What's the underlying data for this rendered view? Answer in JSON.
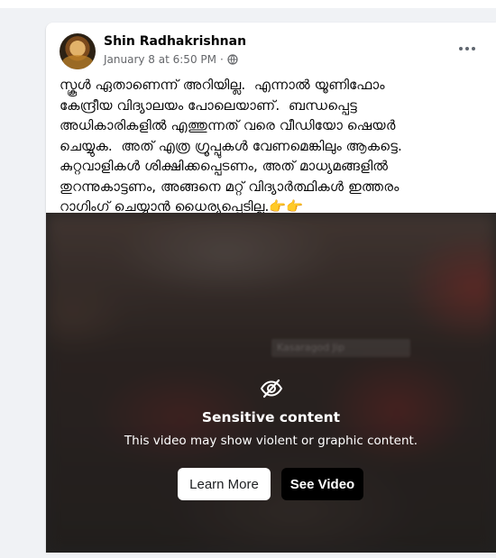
{
  "post": {
    "author": "Shin Radhakrishnan",
    "timestamp": "January 8 at 6:50 PM",
    "separator": "·",
    "audience_icon": "globe-icon",
    "more_icon": "ellipsis-icon",
    "text_lines": [
      "സ്കൂൾ ഏതാണെന്ന് അറിയില്ല.  എന്നാൽ യൂണിഫോം",
      "കേന്ദ്രീയ വിദ്യാലയം പോലെയാണ്.  ബന്ധപ്പെട്ട",
      "അധികാരികളിൽ എത്തുന്നത് വരെ വീഡിയോ ഷെയർ",
      "ചെയ്യുക.  അത് എത്ര ഗ്രൂപ്പുകൾ വേണമെങ്കിലും ആകട്ടെ.",
      "കുറ്റവാളികൾ ശിക്ഷിക്കപ്പെടണം, അത് മാധ്യമങ്ങളിൽ",
      "തുറന്നുകാട്ടണം, അങ്ങനെ മറ്റ് വിദ്യാർത്ഥികൾ ഇത്തരം",
      "റാഗിംഗ് ചെയ്യാൻ ധൈര്യപ്പെടില്ല.👉👉"
    ]
  },
  "video": {
    "watermark": "Kasaragod Jip",
    "sensitive_icon": "eye-slash-icon",
    "title": "Sensitive content",
    "description": "This video may show violent or graphic content.",
    "learn_more_label": "Learn More",
    "see_video_label": "See Video"
  },
  "colors": {
    "page_bg": "#f0f2f5",
    "card_bg": "#ffffff",
    "primary_text": "#050505",
    "secondary_text": "#65676b",
    "learn_button_bg": "#ffffff",
    "see_button_bg": "#000000"
  }
}
